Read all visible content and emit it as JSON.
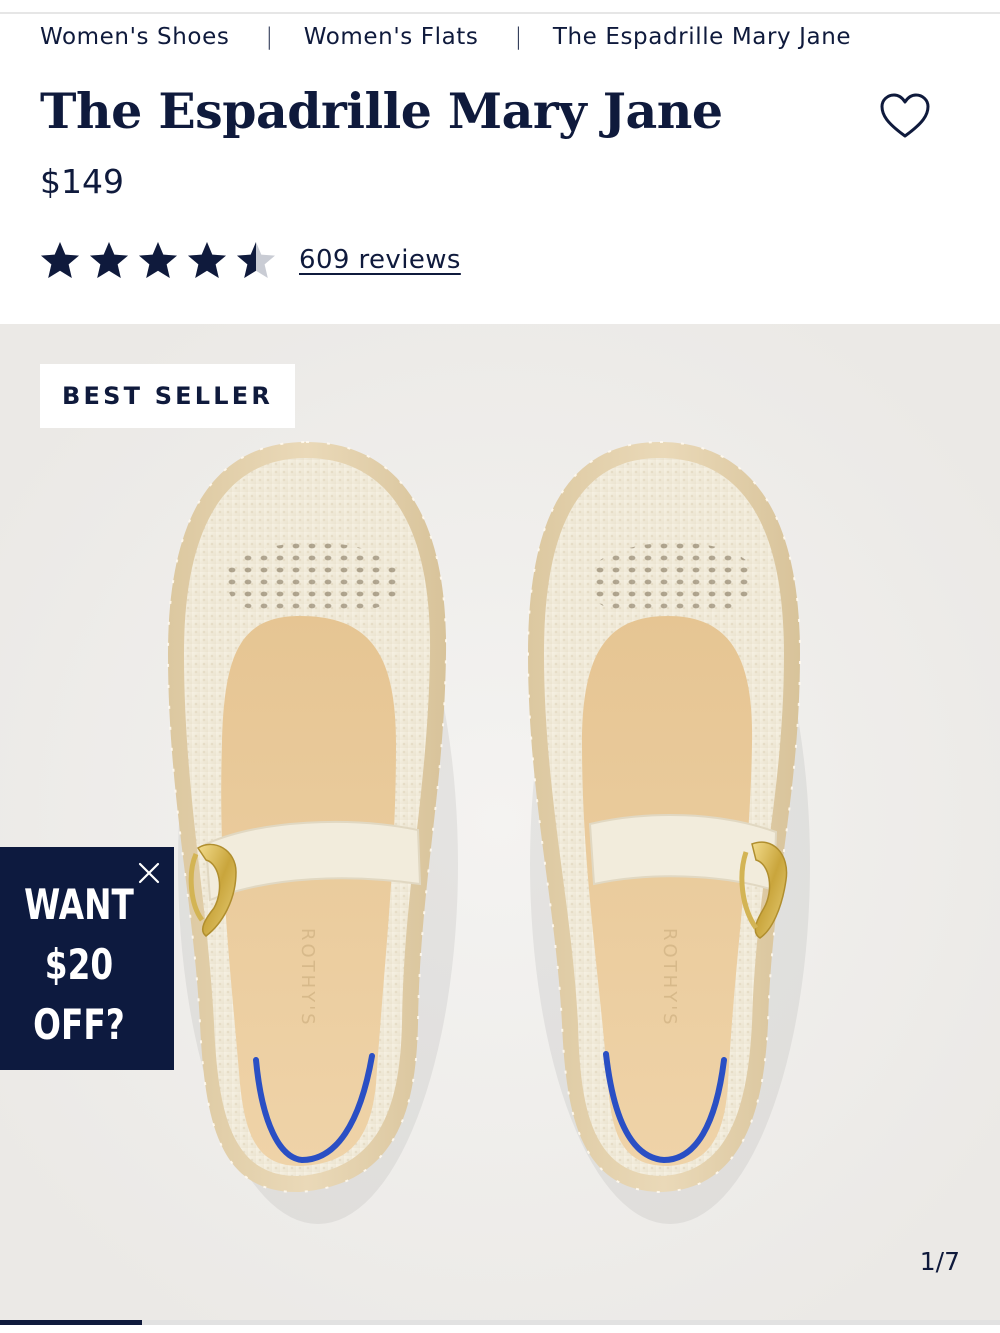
{
  "breadcrumb": {
    "items": [
      "Women's Shoes",
      "Women's Flats",
      "The Espadrille Mary Jane"
    ],
    "separator": "|"
  },
  "product": {
    "title": "The Espadrille Mary Jane",
    "price": "$149",
    "rating_value": 4.5,
    "rating_max": 5,
    "reviews_label": "609 reviews",
    "wishlist_icon": "heart-outline-icon"
  },
  "gallery": {
    "badge": "BEST SELLER",
    "counter": "1/7",
    "current_index": 1,
    "total": 7,
    "progress_fraction": 0.142,
    "brand_mark": "ROTHY'S"
  },
  "promo": {
    "line1": "WANT",
    "line2": "$20",
    "line3": "OFF?",
    "close_icon": "close-icon"
  },
  "colors": {
    "navy": "#0f1a3c",
    "gallery_bg": "#efedea",
    "promo_bg": "#0d1a3f",
    "star_empty": "#c9ccd4"
  }
}
